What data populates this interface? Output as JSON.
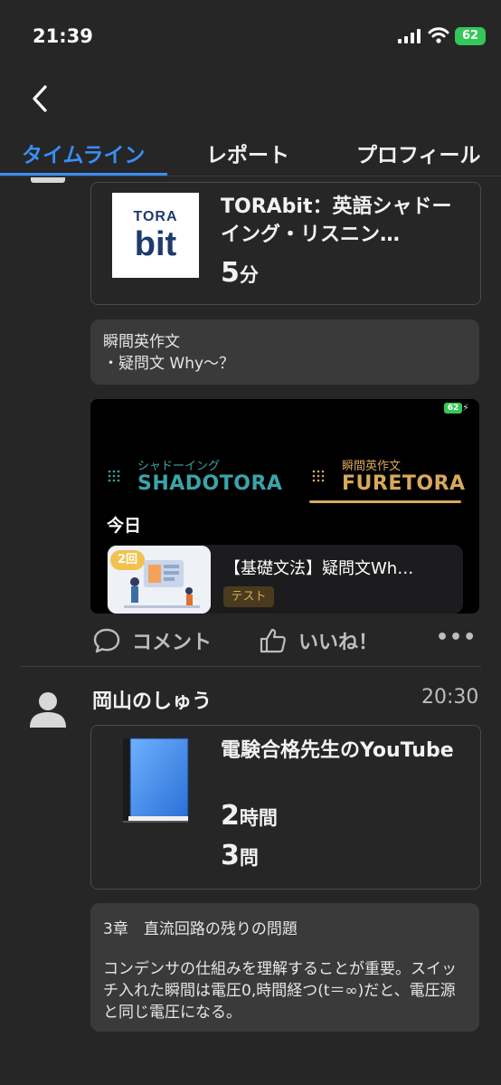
{
  "status_bar": {
    "time": "21:39",
    "battery": "62"
  },
  "tabs": [
    {
      "label": "タイムライン"
    },
    {
      "label": "レポート"
    },
    {
      "label": "プロフィール"
    }
  ],
  "post1": {
    "material": {
      "title": "TORAbit：英語シャドーイング・リスニン…",
      "logo_top": "TORA",
      "logo_bottom": "bit",
      "duration_num": "5",
      "duration_unit": "分"
    },
    "note": "瞬間英作文\n・疑問文 Why〜？",
    "screenshot": {
      "battery": "62",
      "app1_small": "シャドーイング",
      "app1_big": "SHADOTORA",
      "app2_small": "瞬間英作文",
      "app2_big": "FURETORA",
      "today": "今日",
      "lesson_badge": "2回",
      "lesson_title": "【基礎文法】疑問文Wh…",
      "lesson_tag": "テスト"
    },
    "actions": {
      "comment": "コメント",
      "like": "いいね！",
      "more": "•••"
    }
  },
  "post2": {
    "user": "岡山のしゅう",
    "time": "20:30",
    "material": {
      "title": "電験合格先生のYouTube",
      "dur1_num": "2",
      "dur1_unit": "時間",
      "dur2_num": "3",
      "dur2_unit": "問"
    },
    "note_title": "3章　直流回路の残りの問題",
    "note_body": "コンデンサの仕組みを理解することが重要。スイッチ入れた瞬間は電圧0,時間経つ(t＝∞)だと、電圧源と同じ電圧になる。"
  },
  "colors": {
    "accent": "#3a8ef6",
    "background": "#262626",
    "shado": "#3aa4a8",
    "fure": "#d9a85a"
  }
}
